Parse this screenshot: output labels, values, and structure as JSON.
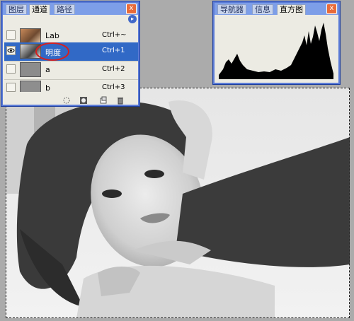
{
  "channels_panel": {
    "tabs": [
      "图层",
      "通道",
      "路径"
    ],
    "channels": [
      {
        "name": "Lab",
        "shortcut": "Ctrl+~"
      },
      {
        "name": "明度",
        "shortcut": "Ctrl+1"
      },
      {
        "name": "a",
        "shortcut": "Ctrl+2"
      },
      {
        "name": "b",
        "shortcut": "Ctrl+3"
      }
    ],
    "close_glyph": "x",
    "menu_glyph": "▸"
  },
  "histogram_panel": {
    "tabs": [
      "导航器",
      "信息",
      "直方图"
    ],
    "close_glyph": "x"
  },
  "icons": [
    "eye-icon",
    "dotted-circle-icon",
    "channel-mask-icon",
    "new-channel-icon",
    "trash-icon"
  ],
  "colors": {
    "accent": "#3169c6",
    "palette_border": "#5b7bd6",
    "highlight_ellipse": "#d42020"
  }
}
